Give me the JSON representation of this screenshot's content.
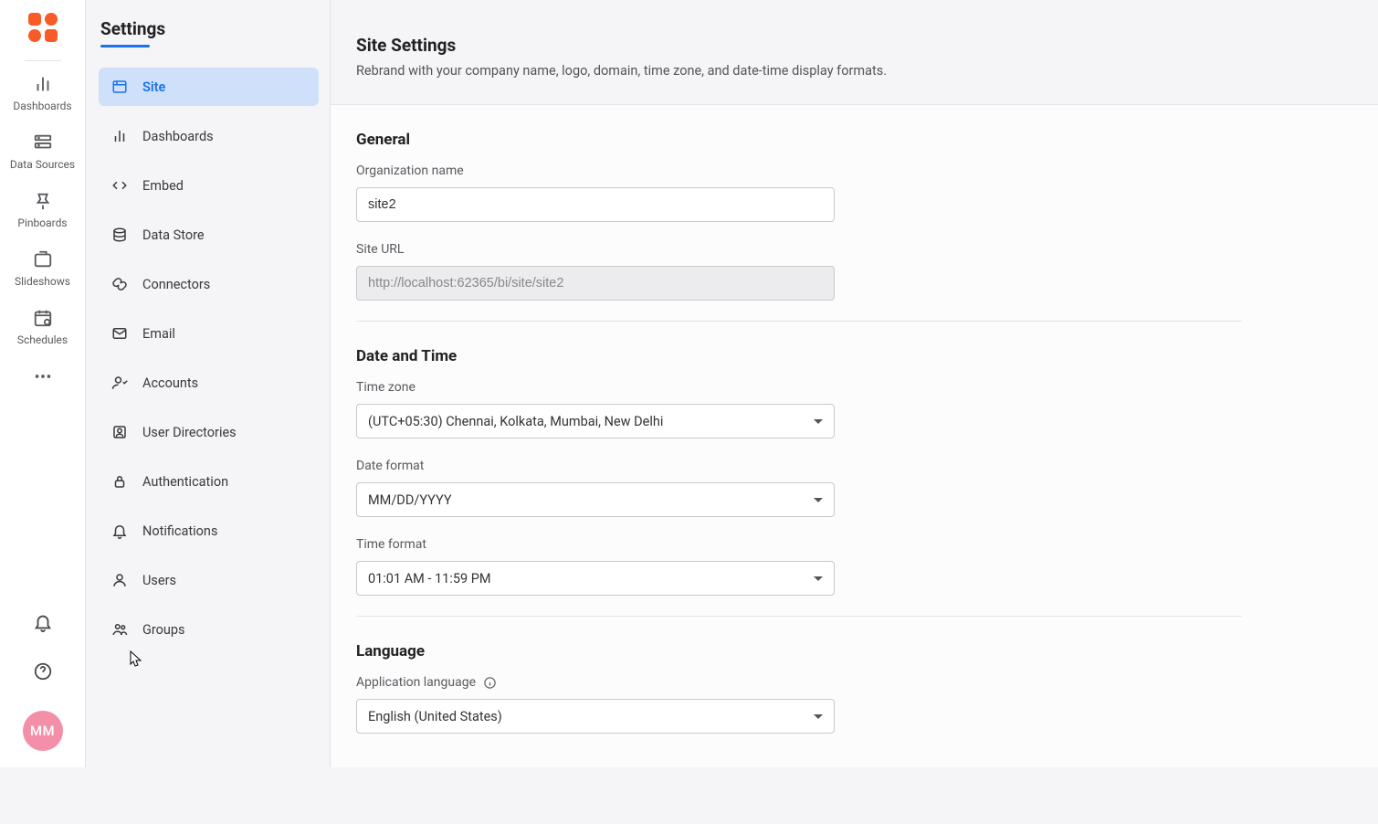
{
  "rail": {
    "items": [
      {
        "label": "Dashboards"
      },
      {
        "label": "Data Sources"
      },
      {
        "label": "Pinboards"
      },
      {
        "label": "Slideshows"
      },
      {
        "label": "Schedules"
      }
    ],
    "avatar": "MM"
  },
  "settings": {
    "title": "Settings",
    "nav": [
      {
        "label": "Site"
      },
      {
        "label": "Dashboards"
      },
      {
        "label": "Embed"
      },
      {
        "label": "Data Store"
      },
      {
        "label": "Connectors"
      },
      {
        "label": "Email"
      },
      {
        "label": "Accounts"
      },
      {
        "label": "User Directories"
      },
      {
        "label": "Authentication"
      },
      {
        "label": "Notifications"
      },
      {
        "label": "Users"
      },
      {
        "label": "Groups"
      }
    ]
  },
  "page": {
    "title": "Site Settings",
    "subtitle": "Rebrand with your company name, logo, domain, time zone, and date-time display formats.",
    "general": {
      "heading": "General",
      "org_label": "Organization name",
      "org_value": "site2",
      "url_label": "Site URL",
      "url_value": "http://localhost:62365/bi/site/site2"
    },
    "datetime": {
      "heading": "Date and Time",
      "tz_label": "Time zone",
      "tz_value": "(UTC+05:30) Chennai, Kolkata, Mumbai, New Delhi",
      "date_label": "Date format",
      "date_value": "MM/DD/YYYY",
      "time_label": "Time format",
      "time_value": "01:01 AM - 11:59 PM"
    },
    "language": {
      "heading": "Language",
      "app_label": "Application language",
      "app_value": "English (United States)"
    }
  }
}
